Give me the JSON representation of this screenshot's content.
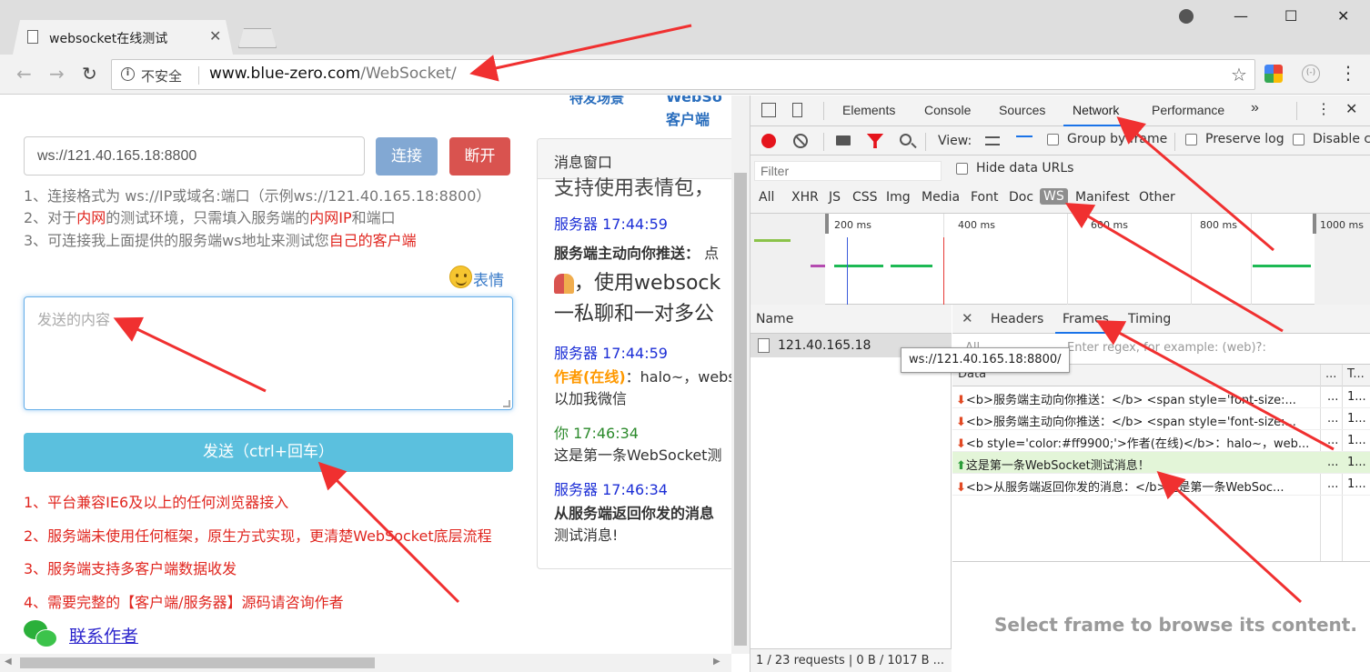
{
  "browser": {
    "tab_title": "websocket在线测试",
    "tab_close": "✕",
    "window_min": "—",
    "window_max": "☐",
    "window_close": "✕",
    "back": "←",
    "forward": "→",
    "reload": "↻",
    "security_icon": "i",
    "security_text": "不安全",
    "url_host": "www.blue-zero.com",
    "url_path": "/WebSocket/",
    "star": "☆",
    "ext2_label": "(-)",
    "menu": "⋮"
  },
  "page": {
    "top_clip_1": "特发场景",
    "top_clip_2": "WebSo",
    "top_clip_3": "客户端",
    "ws_url_value": "ws://121.40.165.18:8800",
    "connect_label": "连接",
    "disconnect_label": "断开",
    "help": [
      {
        "pre": "1、连接格式为 ws://IP或域名:端口（示例ws://121.40.165.18:8800）"
      },
      {
        "pre": "2、对于",
        "red1": "内网",
        "mid": "的测试环境，只需填入服务端的",
        "red2": "内网IP",
        "post": "和端口"
      },
      {
        "pre": "3、可连接我上面提供的服务端ws地址来测试您",
        "red1": "自己的客户端"
      }
    ],
    "emoji_label": "表情",
    "message_placeholder": "发送的内容",
    "send_label": "发送（ctrl+回车）",
    "features": [
      "1、平台兼容IE6及以上的任何浏览器接入",
      "2、服务端未使用任何框架，原生方式实现，更清楚WebSocket底层流程",
      "3、服务端支持多客户端数据收发",
      "4、需要完整的【客户端/服务器】源码请咨询作者"
    ],
    "contact_label": "联系作者",
    "message_window": {
      "title": "消息窗口",
      "clip_top": "支持使用表情包，",
      "msg1_meta": "服务器 17:44:59",
      "msg1_bold": "服务端主动向你推送：",
      "msg1_tail": " 点",
      "msg1_big1": "，使用websock",
      "msg1_big2": "一私聊和一对多公",
      "msg2_meta": "服务器 17:44:59",
      "msg2_author": "作者(在线)",
      "msg2_text": "：halo~，webs",
      "msg2_line2": "以加我微信",
      "msg3_meta": "你 17:46:34",
      "msg3_text": "这是第一条WebSocket测",
      "msg4_meta": "服务器 17:46:34",
      "msg4_bold": "从服务端返回你发的消息",
      "msg4_line2": "测试消息!"
    }
  },
  "devtools": {
    "tabs": [
      "Elements",
      "Console",
      "Sources",
      "Network",
      "Performance"
    ],
    "active_tab": "Network",
    "more_tabs": "»",
    "kebab": "⋮",
    "close": "✕",
    "view_label": "View:",
    "group_by_frame": "Group by frame",
    "preserve_log": "Preserve log",
    "disable_cache": "Disable cache",
    "filter_placeholder": "Filter",
    "hide_data_urls": "Hide data URLs",
    "types": [
      "All",
      "XHR",
      "JS",
      "CSS",
      "Img",
      "Media",
      "Font",
      "Doc",
      "WS",
      "Manifest",
      "Other"
    ],
    "active_type": "WS",
    "timeline_labels": [
      "200 ms",
      "400 ms",
      "600 ms",
      "800 ms",
      "1000 ms"
    ],
    "name_header": "Name",
    "request_name": "121.40.165.18",
    "tooltip": "ws://121.40.165.18:8800/",
    "status": "1 / 23 requests  |  0 B / 1017 B ...",
    "detail_close": "✕",
    "detail_tabs": [
      "Headers",
      "Frames",
      "Timing"
    ],
    "active_detail_tab": "Frames",
    "frame_filter_all": "All",
    "frame_filter_placeholder": "Enter regex, for example: (web)?:",
    "frames_header": [
      "Data",
      "...",
      "T..."
    ],
    "frames": [
      {
        "dir": "down",
        "data": "<b>服务端主动向你推送：</b> <span style='font-size:...",
        "c2": "...",
        "c3": "1..."
      },
      {
        "dir": "down",
        "data": "<b>服务端主动向你推送：</b> <span style='font-size:...",
        "c2": "...",
        "c3": "1..."
      },
      {
        "dir": "down",
        "data": "<b style='color:#ff9900;'>作者(在线)</b>：halo~，web...",
        "c2": "...",
        "c3": "1..."
      },
      {
        "dir": "up",
        "data": "这是第一条WebSocket测试消息！",
        "c2": "...",
        "c3": "1..."
      },
      {
        "dir": "down",
        "data": "<b>从服务端返回你发的消息：</b>这是第一条WebSoc...",
        "c2": "...",
        "c3": "1..."
      }
    ],
    "select_frame_msg": "Select frame to browse its content."
  },
  "colors": {
    "annotation_arrow": "#f03030",
    "accent_blue": "#1a73e8",
    "danger": "#d9534f",
    "info": "#5bc0de"
  }
}
